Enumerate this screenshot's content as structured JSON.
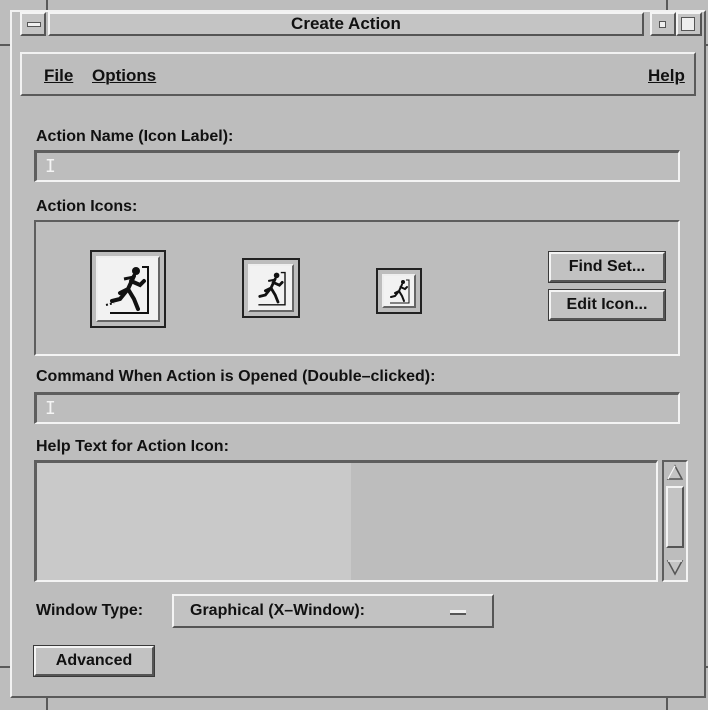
{
  "window": {
    "title": "Create Action"
  },
  "menubar": {
    "file": "File",
    "options": "Options",
    "help": "Help"
  },
  "form": {
    "action_name_label": "Action Name (Icon Label):",
    "action_name_value": "",
    "action_icons_label": "Action Icons:",
    "find_set_button": "Find Set...",
    "edit_icon_button": "Edit Icon...",
    "command_label": "Command When Action is Opened (Double–clicked):",
    "command_value": "",
    "help_text_label": "Help Text for Action Icon:",
    "help_text_value": "",
    "window_type_label": "Window Type:",
    "window_type_value": "Graphical (X–Window):",
    "advanced_button": "Advanced"
  },
  "icons": {
    "window_menu": "window-menu-icon",
    "minimize": "minimize-icon",
    "maximize": "maximize-icon",
    "action_icon": "running-man-icon",
    "scroll_up": "scroll-up-arrow-icon",
    "scroll_down": "scroll-down-arrow-icon"
  },
  "colors": {
    "background": "#bdbdbd",
    "shadow": "#5a5a5a",
    "highlight": "#f2f2f2"
  }
}
